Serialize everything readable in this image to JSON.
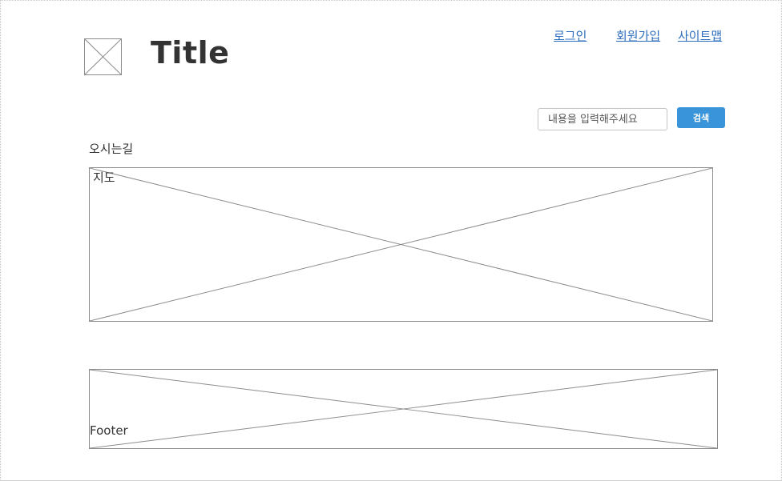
{
  "header": {
    "title": "Title",
    "logo_icon": "image-placeholder-icon"
  },
  "nav": {
    "login": "로그인",
    "signup": "회원가입",
    "sitemap": "사이트맵"
  },
  "search": {
    "placeholder": "내용을 입력해주세요",
    "value": "",
    "button_label": "검색"
  },
  "main": {
    "heading": "오시는길",
    "map_label": "지도"
  },
  "footer": {
    "label": "Footer"
  },
  "colors": {
    "link": "#2d6fbf",
    "button": "#3a94d9",
    "text": "#333333",
    "placeholder_line": "#8c8c8c"
  }
}
